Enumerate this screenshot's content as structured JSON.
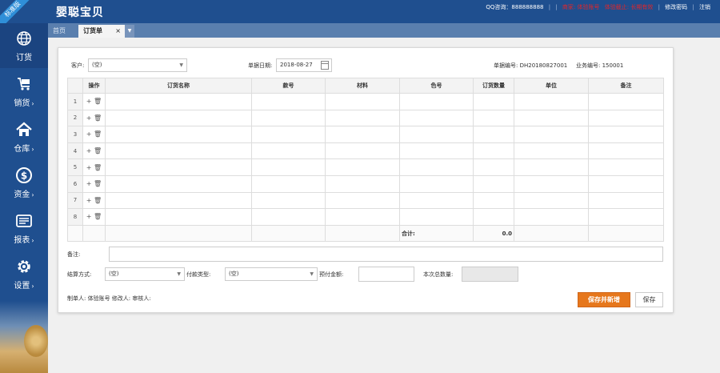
{
  "app": {
    "ribbon": "标准版",
    "title": "婴聪宝贝"
  },
  "top_links": {
    "qq": "QQ咨询：888888888",
    "red1": "商家: 体验账号",
    "red2": "体验截止: 长期有效",
    "change_password": "修改密码",
    "logout": "注销"
  },
  "sidebar": {
    "items": [
      {
        "label": "订货",
        "icon": "globe-icon"
      },
      {
        "label": "销货",
        "icon": "cart-icon"
      },
      {
        "label": "仓库",
        "icon": "home-icon"
      },
      {
        "label": "资金",
        "icon": "dollar-icon"
      },
      {
        "label": "报表",
        "icon": "report-icon"
      },
      {
        "label": "设置",
        "icon": "gear-icon"
      }
    ],
    "arrow": "›"
  },
  "tabs": {
    "home": "首页",
    "order": "订货单",
    "close": "×",
    "more": "▼"
  },
  "form": {
    "customer_label": "客户:",
    "customer_value": "(空)",
    "date_label": "单据日期:",
    "date_value": "2018-08-27",
    "doc_no_label": "单据编号: DH20180827001",
    "biz_no_label": "业务编号: 150001"
  },
  "table": {
    "headers": [
      "操作",
      "订货名称",
      "款号",
      "材料",
      "色号",
      "订货数量",
      "单位",
      "备注"
    ],
    "rows": [
      "1",
      "2",
      "3",
      "4",
      "5",
      "6",
      "7",
      "8"
    ],
    "ops": "+ 🗑",
    "total_label": "合计:",
    "total_value": "0.0"
  },
  "footer": {
    "remark_label": "备注:",
    "settle_label": "结算方式:",
    "settle_value": "(空)",
    "pay_type_label": "付款类型:",
    "pay_type_value": "(空)",
    "prepay_label": "预付金额:",
    "total_qty_label": "本次总数量:",
    "people": "制单人: 体验账号  修改人:  审核人:",
    "save_new": "保存并新增",
    "save": "保存"
  }
}
